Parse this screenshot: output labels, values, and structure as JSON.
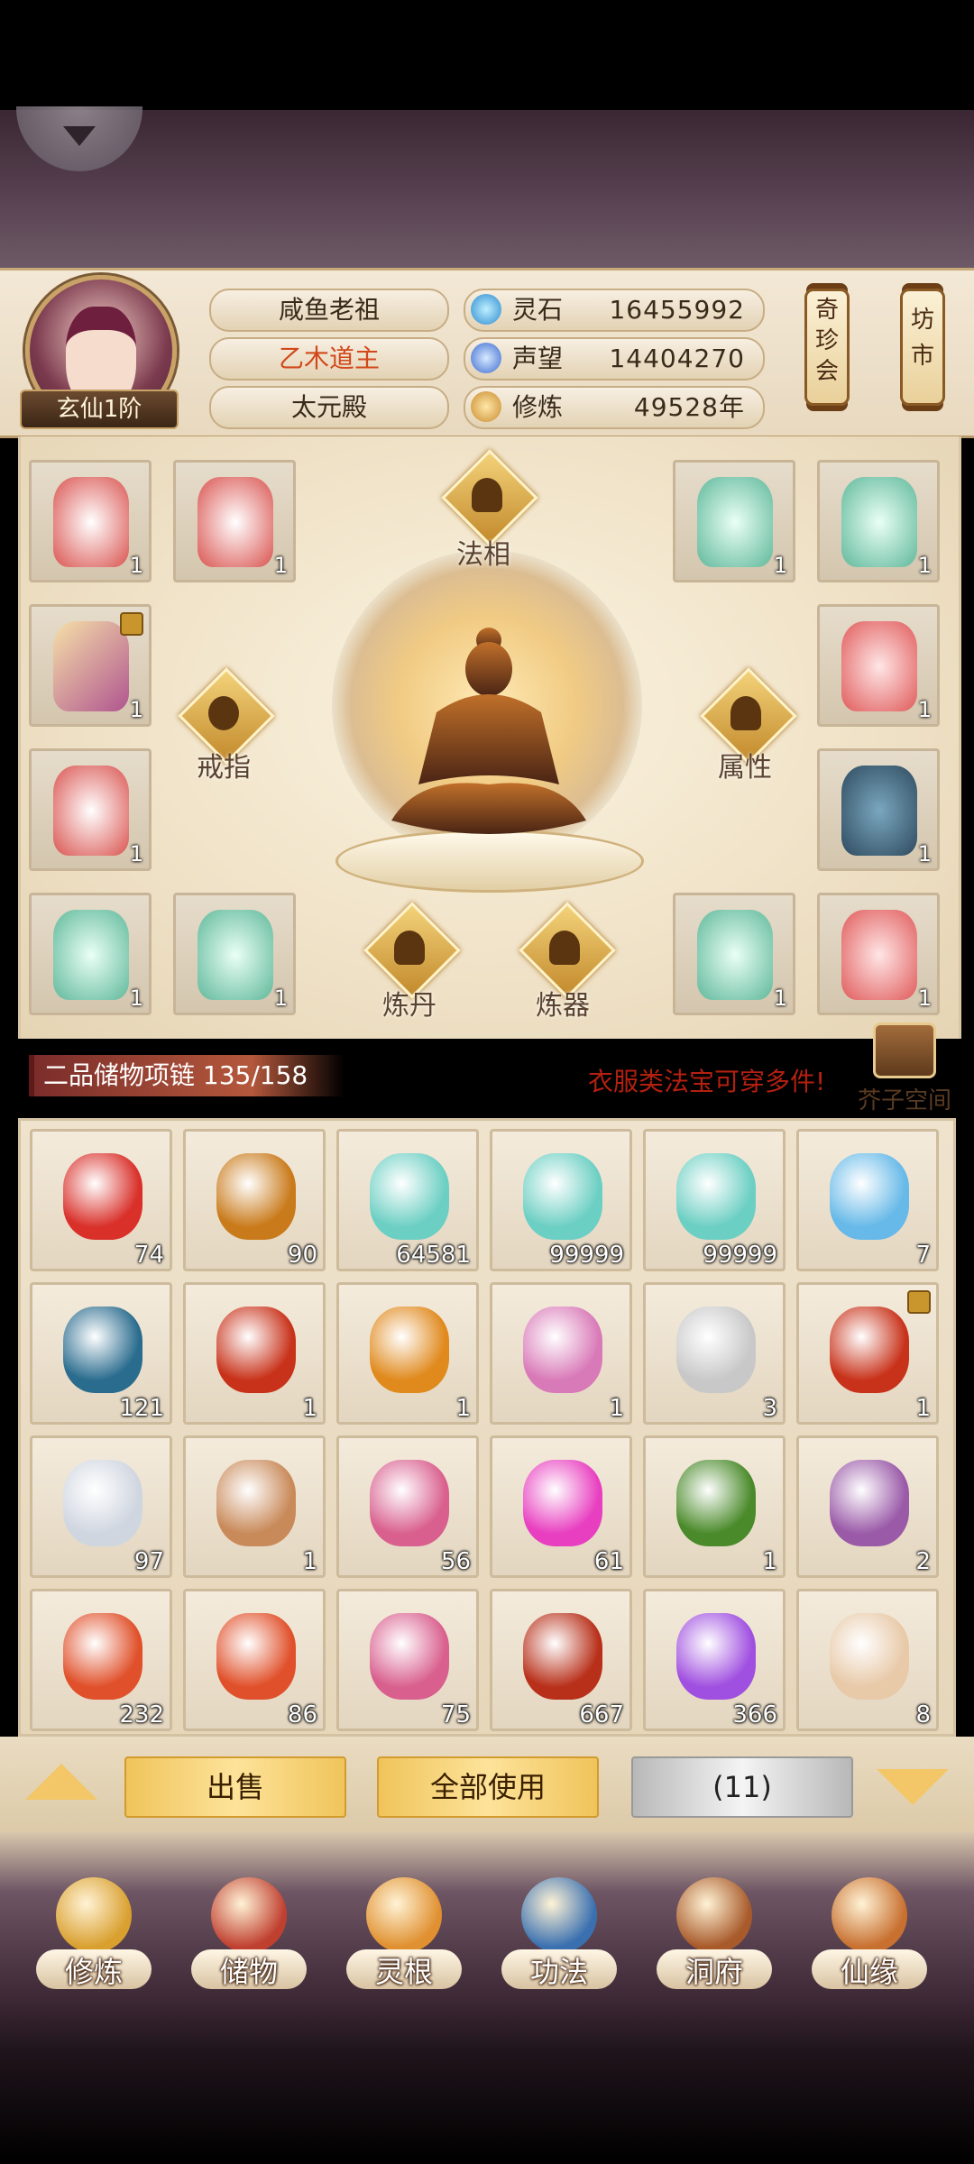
{
  "header": {
    "realm": "玄仙1阶",
    "player_name": "咸鱼老祖",
    "title": "乙木道主",
    "sect": "太元殿",
    "resources": [
      {
        "label": "灵石",
        "value": "16455992",
        "icon": "spirit-stone-icon"
      },
      {
        "label": "声望",
        "value": "14404270",
        "icon": "reputation-icon"
      },
      {
        "label": "修炼",
        "value": "49528年",
        "icon": "cultivation-icon"
      }
    ],
    "shops": [
      {
        "label": "奇珍会"
      },
      {
        "label": "坊市"
      }
    ]
  },
  "equip_area": {
    "slots": [
      {
        "count": "1",
        "color": "#d9534f"
      },
      {
        "count": "1",
        "color": "#d9534f"
      },
      {
        "count": "1",
        "color": "#5fb89a"
      },
      {
        "count": "1",
        "color": "#5fb89a"
      },
      {
        "count": "1",
        "color": "#b0558f"
      },
      {
        "count": "1",
        "color": "#e05a5a"
      },
      {
        "count": "1",
        "color": "#d9534f"
      },
      {
        "count": "1",
        "color": "#2e4a5e"
      },
      {
        "count": "1",
        "color": "#5fb89a"
      },
      {
        "count": "1",
        "color": "#5fb89a"
      },
      {
        "count": "1",
        "color": "#5fb89a"
      },
      {
        "count": "1",
        "color": "#e05a5a"
      }
    ],
    "functions": {
      "faxiang": "法相",
      "ring": "戒指",
      "attributes": "属性",
      "alchemy": "炼丹",
      "forging": "炼器"
    }
  },
  "bag": {
    "title": "二品储物项链 135/158",
    "note": "衣服类法宝可穿多件!",
    "space_label": "芥子空间",
    "items": [
      {
        "count": "74",
        "color": "#d9302a"
      },
      {
        "count": "90",
        "color": "#c97a1a"
      },
      {
        "count": "64581",
        "color": "#6ccfc3"
      },
      {
        "count": "99999",
        "color": "#6ccfc3"
      },
      {
        "count": "99999",
        "color": "#6ccfc3"
      },
      {
        "count": "7",
        "color": "#66b9e8"
      },
      {
        "count": "121",
        "color": "#2a6c8e"
      },
      {
        "count": "1",
        "color": "#c8321a"
      },
      {
        "count": "1",
        "color": "#e0891c"
      },
      {
        "count": "1",
        "color": "#d97ab8"
      },
      {
        "count": "3",
        "color": "#c8c8c8"
      },
      {
        "count": "1",
        "color": "#c8321a"
      },
      {
        "count": "97",
        "color": "#d0d6e0"
      },
      {
        "count": "1",
        "color": "#c98a5a"
      },
      {
        "count": "56",
        "color": "#d9608e"
      },
      {
        "count": "61",
        "color": "#e83fc0"
      },
      {
        "count": "1",
        "color": "#4a8a2a"
      },
      {
        "count": "2",
        "color": "#9a5aa8"
      },
      {
        "count": "232",
        "color": "#e0502a"
      },
      {
        "count": "86",
        "color": "#e0502a"
      },
      {
        "count": "75",
        "color": "#d9608e"
      },
      {
        "count": "667",
        "color": "#b8301a"
      },
      {
        "count": "366",
        "color": "#a050e0"
      },
      {
        "count": "8",
        "color": "#e8c9a8"
      }
    ],
    "sell_label": "出售",
    "use_all_label": "全部使用",
    "selected_label": "(11)"
  },
  "nav": [
    {
      "label": "修炼",
      "icon": "cultivate-icon",
      "color": "#d9a030"
    },
    {
      "label": "储物",
      "icon": "storage-bag-icon",
      "color": "#c04030"
    },
    {
      "label": "灵根",
      "icon": "spirit-root-icon",
      "color": "#e09030"
    },
    {
      "label": "功法",
      "icon": "technique-book-icon",
      "color": "#3a70b0"
    },
    {
      "label": "洞府",
      "icon": "cave-residence-icon",
      "color": "#a85a2a"
    },
    {
      "label": "仙缘",
      "icon": "fortune-gourd-icon",
      "color": "#c87030"
    }
  ]
}
